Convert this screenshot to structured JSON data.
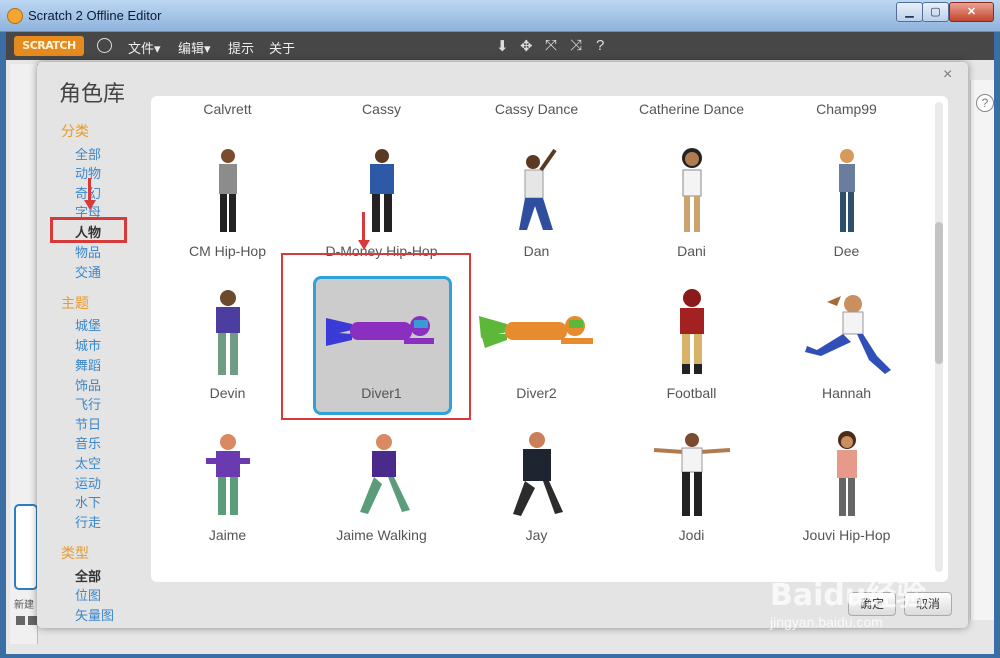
{
  "window": {
    "title": "Scratch 2 Offline Editor",
    "min_glyph": "▁",
    "max_glyph": "▢",
    "close_glyph": "✕"
  },
  "menubar": {
    "logo": "SCRATCH",
    "items": [
      "文件▾",
      "编辑▾",
      "提示",
      "关于"
    ],
    "tools": [
      "⬇",
      "✥",
      "⤧",
      "⤨",
      "?"
    ]
  },
  "editor": {
    "help_glyph": "?",
    "new_sprite_label": "新建"
  },
  "dialog": {
    "title": "角色库",
    "close_glyph": "×",
    "sections": [
      {
        "heading": "分类",
        "items": [
          "全部",
          "动物",
          "奇幻",
          "字母",
          "人物",
          "物品",
          "交通"
        ],
        "active": "人物"
      },
      {
        "heading": "主题",
        "items": [
          "城堡",
          "城市",
          "舞蹈",
          "饰品",
          "飞行",
          "节日",
          "音乐",
          "太空",
          "运动",
          "水下",
          "行走"
        ]
      },
      {
        "heading": "类型",
        "items": [
          "全部",
          "位图",
          "矢量图"
        ],
        "active": "全部"
      }
    ],
    "top_row": [
      "Calvrett",
      "Cassy",
      "Cassy Dance",
      "Catherine Dance",
      "Champ99"
    ],
    "rows": [
      [
        "CM Hip-Hop",
        "D-Money Hip-Hop",
        "Dan",
        "Dani",
        "Dee"
      ],
      [
        "Devin",
        "Diver1",
        "Diver2",
        "Football",
        "Hannah"
      ],
      [
        "Jaime",
        "Jaime Walking",
        "Jay",
        "Jodi",
        "Jouvi Hip-Hop"
      ]
    ],
    "selected": "Diver1",
    "ok_label": "确定",
    "cancel_label": "取消"
  },
  "watermark": {
    "brand": "Baidu经验",
    "url": "jingyan.baidu.com"
  },
  "colors": {
    "accent_orange": "#e99a2b",
    "link_blue": "#3a87c9",
    "selection_blue": "#2fa2d9",
    "annotation_red": "#d63a3a"
  }
}
